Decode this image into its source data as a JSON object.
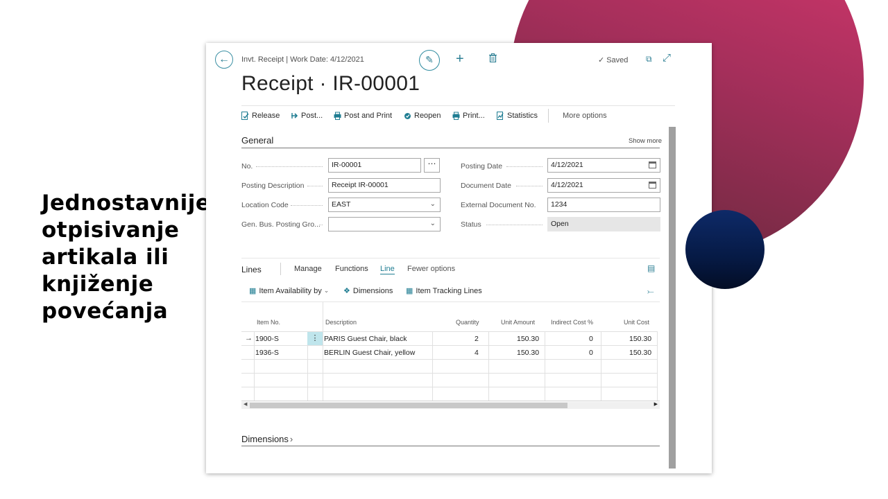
{
  "headline": [
    "Jednostavnije",
    "otpisivanje",
    "artikala ili",
    "knjiženje",
    "povećanja"
  ],
  "window": {
    "breadcrumb": "Invt. Receipt | Work Date: 4/12/2021",
    "title": "Receipt · IR-00001",
    "saved": "Saved"
  },
  "actions": {
    "release": "Release",
    "post": "Post...",
    "post_print": "Post and Print",
    "reopen": "Reopen",
    "print": "Print...",
    "statistics": "Statistics",
    "more_options": "More options"
  },
  "general": {
    "title": "General",
    "show_more": "Show more",
    "fields": {
      "no": {
        "label": "No.",
        "value": "IR-00001"
      },
      "posting_description": {
        "label": "Posting Description",
        "value": "Receipt IR-00001"
      },
      "location_code": {
        "label": "Location Code",
        "value": "EAST"
      },
      "gen_bus_posting_group": {
        "label": "Gen. Bus. Posting Gro...",
        "value": ""
      },
      "posting_date": {
        "label": "Posting Date",
        "value": "4/12/2021"
      },
      "document_date": {
        "label": "Document Date",
        "value": "4/12/2021"
      },
      "external_document_no": {
        "label": "External Document No.",
        "value": "1234"
      },
      "status": {
        "label": "Status",
        "value": "Open"
      }
    }
  },
  "lines": {
    "title": "Lines",
    "tabs": [
      "Manage",
      "Functions",
      "Line",
      "Fewer options"
    ],
    "active_tab": "Line",
    "sub_actions": [
      "Item Availability by",
      "Dimensions",
      "Item Tracking Lines"
    ],
    "columns": [
      "Item No.",
      "Description",
      "Quantity",
      "Unit Amount",
      "Indirect Cost %",
      "Unit Cost"
    ],
    "rows": [
      {
        "item_no": "1900-S",
        "description": "PARIS Guest Chair, black",
        "quantity": "2",
        "unit_amount": "150.30",
        "indirect_cost": "0",
        "unit_cost": "150.30"
      },
      {
        "item_no": "1936-S",
        "description": "BERLIN Guest Chair, yellow",
        "quantity": "4",
        "unit_amount": "150.30",
        "indirect_cost": "0",
        "unit_cost": "150.30"
      }
    ]
  },
  "dimensions": {
    "title": "Dimensions"
  },
  "colors": {
    "accent": "#1f7d92",
    "deco_pink": "#d8386f",
    "deco_navy": "#0e2a68"
  }
}
